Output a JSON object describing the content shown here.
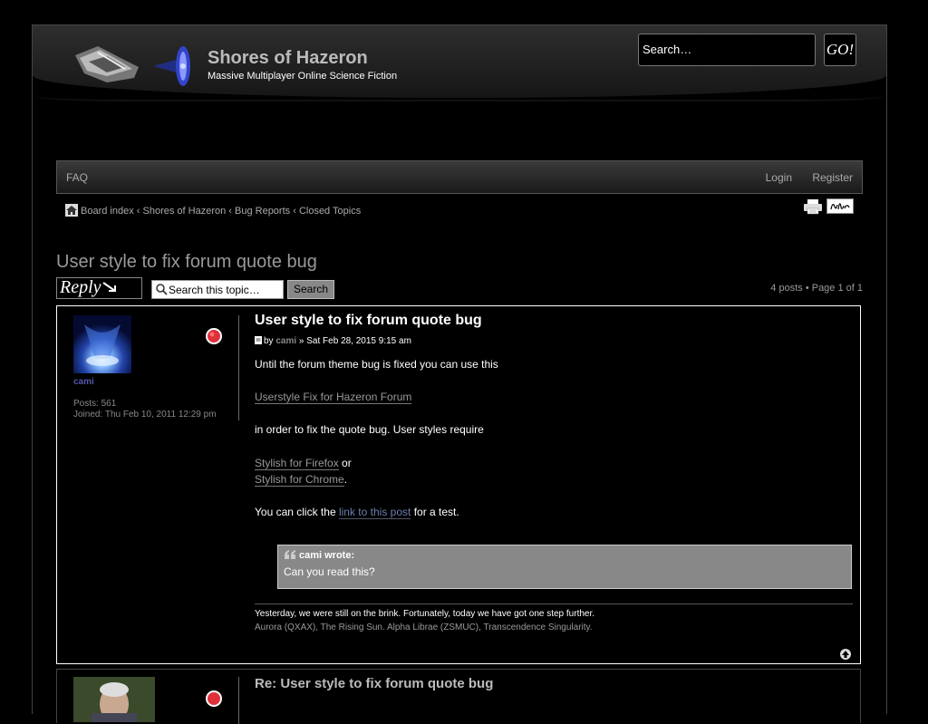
{
  "header": {
    "site_title": "Shores of Hazeron",
    "site_description": "Massive Multiplayer Online Science Fiction",
    "search_placeholder": "Search…",
    "go_label": "GO!"
  },
  "nav": {
    "faq": "FAQ",
    "login": "Login",
    "register": "Register"
  },
  "breadcrumbs": [
    "Board index",
    "Shores of Hazeron",
    "Bug Reports",
    "Closed Topics"
  ],
  "breadcrumb_separator": " ‹ ",
  "topic": {
    "title": "User style to fix forum quote bug",
    "reply_label": "Reply",
    "search_placeholder": "Search this topic…",
    "search_button": "Search",
    "pagination": "4 posts • Page 1 of 1"
  },
  "post1": {
    "author": "cami",
    "posts_label": "Posts: 561",
    "joined_label": "Joined: Thu Feb 10, 2011 12:29 pm",
    "title": "User style to fix forum quote bug",
    "by": "by",
    "meta_sep": "»",
    "date": "Sat Feb 28, 2015 9:15 am",
    "body": {
      "line1": "Until the forum theme bug is fixed you can use this",
      "link1": "Userstyle Fix for Hazeron Forum",
      "line2": "in order to fix the quote bug. User styles require",
      "link2": "Stylish for Firefox",
      "or": "or",
      "link3": "Stylish for Chrome",
      "dot": ".",
      "line3_pre": "You can click the",
      "link4": "link to this post",
      "line3_post": "for a test."
    },
    "quote": {
      "cite": "cami wrote:",
      "text": "Can you read this?"
    },
    "signature": {
      "line1": "Yesterday, we were still on the brink. Fortunately, today we have got one step further.",
      "line2": "Aurora (QXAX), The Rising Sun. Alpha Librae (ZSMUC), Transcendence Singularity."
    }
  },
  "post2": {
    "title": "Re: User style to fix forum quote bug"
  },
  "colors": {
    "background": "#000000",
    "header_text": "#bbbbbb",
    "link_blue": "#6a7eb0",
    "online_indicator": "#e0303a",
    "quote_bg": "#888888"
  }
}
